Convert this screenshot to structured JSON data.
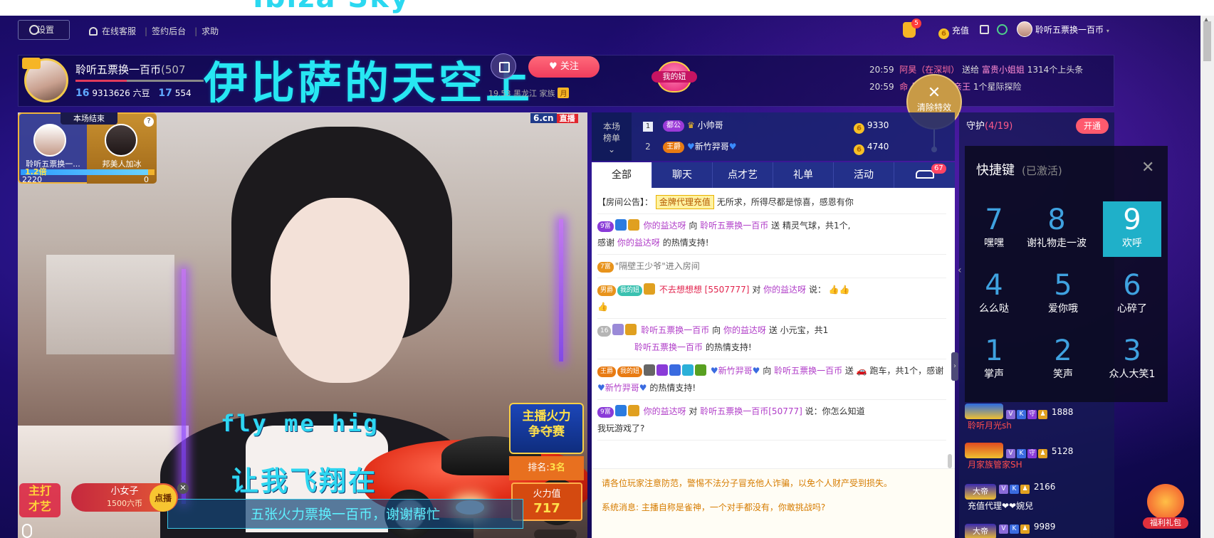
{
  "top_lyric": "Ibiza Sky",
  "topbar": {
    "settings_label": "设置",
    "links": [
      "在线客服",
      "签约后台",
      "求助"
    ],
    "bag_count": "5",
    "recharge_label": "充值",
    "username": "聆听五票换一百币"
  },
  "anchor": {
    "name": "聆听五票换一百币",
    "room_id": "(507",
    "level1": "16",
    "fans": "9313626 六豆",
    "level2": "17",
    "extra": "554",
    "title_overlay": "伊比萨的天空上",
    "follow_label": "关注",
    "sub_tags": "19.53  黑龙江  家族",
    "month_tag": "月",
    "mygirl_label": "我的妞"
  },
  "broadcasts": [
    {
      "time": "20:59",
      "user": "阿昊（在深圳）",
      "action": "送给",
      "target": "富贵小姐姐",
      "text": "1314个上头条"
    },
    {
      "time": "20:59",
      "user": "命",
      "action": "",
      "target": "晶晶贺禅哥亲王",
      "text": "1个星际探险"
    }
  ],
  "clear_fx_label": "清除特效",
  "pk": {
    "end_label": "本场结束",
    "left_name": "聆听五票换一...",
    "right_name": "邦美人加冰",
    "multiplier": "1.2倍",
    "left_score": "2220",
    "right_score": "0",
    "help": "?"
  },
  "video": {
    "brand": "6.cn",
    "live_tag": "直播",
    "lyric1": "fly me hig",
    "lyric2": "让我飞翔在",
    "fire_title1": "主播火力",
    "fire_title2": "争夺赛",
    "rank_label": "排名:",
    "rank_value": "3名",
    "fire_label": "火力值",
    "fire_value": "717",
    "song_label1": "主打",
    "song_label2": "才艺",
    "song_name": "小女子",
    "song_price": "1500六币",
    "song_play": "点播",
    "ticker": "五张火力票换一百币，谢谢帮忙"
  },
  "ranklist": {
    "header1": "本场",
    "header2": "榜单",
    "rows": [
      {
        "no": "1",
        "badge": "都公",
        "name": "小帅哥",
        "score": "9330"
      },
      {
        "no": "2",
        "badge": "王爵",
        "name": "新竹羿哥",
        "score": "4740"
      }
    ]
  },
  "tabs": [
    {
      "label": "全部"
    },
    {
      "label": "聊天"
    },
    {
      "label": "点才艺"
    },
    {
      "label": "礼单"
    },
    {
      "label": "活动"
    },
    {
      "label": "67"
    }
  ],
  "messages": {
    "notice_prefix": "【房间公告】：",
    "notice_tag": "金牌代理充值",
    "notice_text": "无所求，所得尽都是惊喜，感恩有你",
    "m1_lv": "9富",
    "m1_user": "你的益达呀",
    "m1_to": "向",
    "m1_anchor": "聆听五票换一百币",
    "m1_send": "送",
    "m1_gift": "精灵气球，共1个,",
    "m1_thanks": "感谢",
    "m1_user2": "你的益达呀",
    "m1_end": "的热情支持!",
    "m2_lv": "7富",
    "m2_text": "\"隔壁王少爷\"进入房间",
    "m3_lv": "男爵",
    "m3_fan": "我的妞",
    "m3_user": "不去想想想 [5507777]",
    "m3_to": "对",
    "m3_target": "你的益达呀",
    "m3_say": "说：",
    "m4_lv": "16",
    "m4_user": "聆听五票换一百币",
    "m4_to": "向",
    "m4_target": "你的益达呀",
    "m4_send": "送",
    "m4_gift": "小元宝，共1",
    "m4_line2": "聆听五票换一百币",
    "m4_end": "的热情支持!",
    "m5_lv": "王爵",
    "m5_fan": "我的妞",
    "m5_user": "新竹羿哥",
    "m5_to": "向",
    "m5_target": "聆听五票换一百币",
    "m5_send": "送",
    "m5_gift": "跑车，共1个，感谢",
    "m5_user2": "新竹羿哥",
    "m5_end": "的热情支持!",
    "m6_lv": "9富",
    "m6_user": "你的益达呀",
    "m6_to": "对",
    "m6_target": "聆听五票换一百币[50777]",
    "m6_say": "说：你怎么知道",
    "m6_line2": "我玩游戏了?"
  },
  "notices": [
    "请各位玩家注意防范，警惕不法分子冒充他人诈骗，以免个人财产受到损失。",
    "系统消息: 主播自称是雀神，一个对手都没有，你敢挑战吗?"
  ],
  "guard": {
    "title": "守护",
    "count": "(4/19)",
    "open_label": "开通"
  },
  "shortcuts": {
    "title": "快捷键",
    "status": "(已激活)",
    "keys": [
      {
        "n": "7",
        "label": "嘿嘿"
      },
      {
        "n": "8",
        "label": "谢礼物走一波"
      },
      {
        "n": "9",
        "label": "欢呼"
      },
      {
        "n": "4",
        "label": "么么哒"
      },
      {
        "n": "5",
        "label": "爱你哦"
      },
      {
        "n": "6",
        "label": "心碎了"
      },
      {
        "n": "1",
        "label": "掌声"
      },
      {
        "n": "2",
        "label": "笑声"
      },
      {
        "n": "3",
        "label": "众人大笑1"
      }
    ]
  },
  "guard_list": [
    {
      "score": "1888",
      "name": "聆听月光sh"
    },
    {
      "score": "5128",
      "name": "月家族管家SH"
    },
    {
      "badge": "大帝",
      "score": "2166",
      "name": "充值代理❤❤婉兒"
    },
    {
      "badge": "大帝",
      "score": "9989",
      "name": ""
    }
  ],
  "gift_pack_label": "福利礼包",
  "colors": {
    "accent_cyan": "#27e7f2",
    "follow_red": "#f03c5d",
    "tab_bar": "#23308a",
    "user_purple": "#b03dc8"
  }
}
